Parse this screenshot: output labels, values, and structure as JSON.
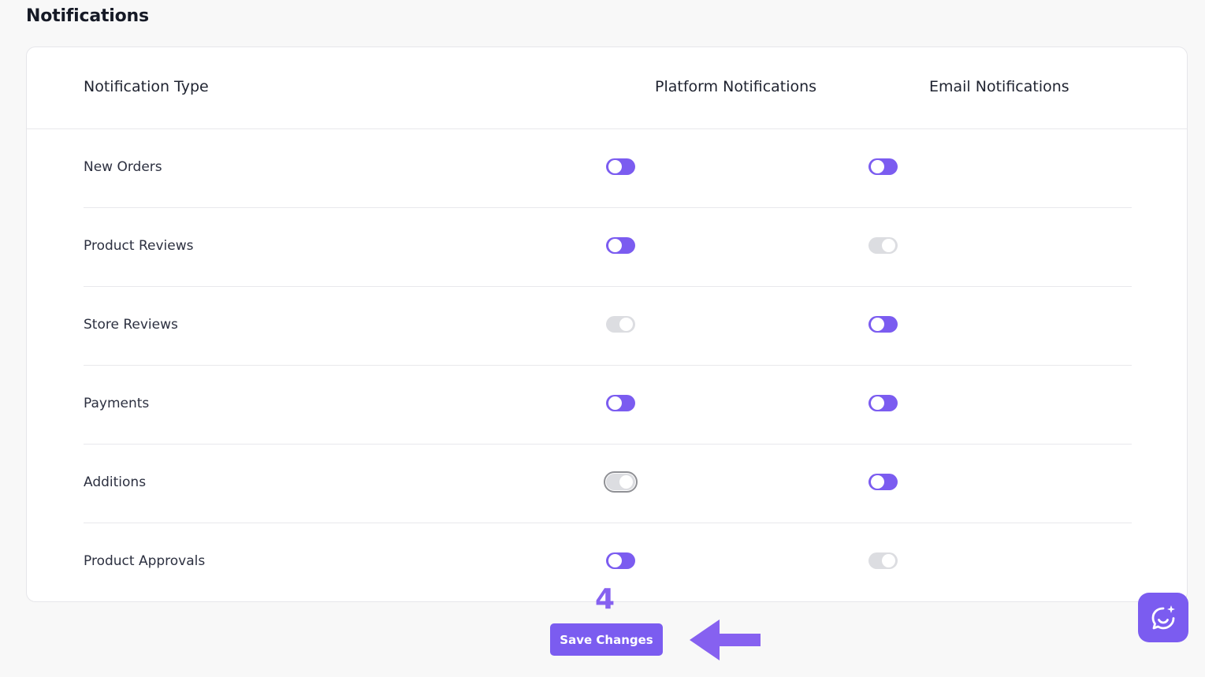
{
  "page": {
    "title": "Notifications"
  },
  "table": {
    "headers": {
      "type": "Notification Type",
      "platform": "Platform Notifications",
      "email": "Email Notifications"
    },
    "rows": [
      {
        "label": "New Orders",
        "platform": true,
        "email": true
      },
      {
        "label": "Product Reviews",
        "platform": true,
        "email": false
      },
      {
        "label": "Store Reviews",
        "platform": false,
        "email": true
      },
      {
        "label": "Payments",
        "platform": true,
        "email": true
      },
      {
        "label": "Additions",
        "platform": false,
        "email": true,
        "platform_focused": true
      },
      {
        "label": "Product Approvals",
        "platform": true,
        "email": false
      }
    ]
  },
  "annotation": {
    "step_number": "4"
  },
  "actions": {
    "save_label": "Save Changes"
  },
  "colors": {
    "accent": "#7b5cf0",
    "toggle_off": "#dcdde1",
    "annotation": "#8661f0"
  },
  "icons": {
    "arrow": "left-arrow-icon",
    "chat": "chat-ai-icon"
  }
}
